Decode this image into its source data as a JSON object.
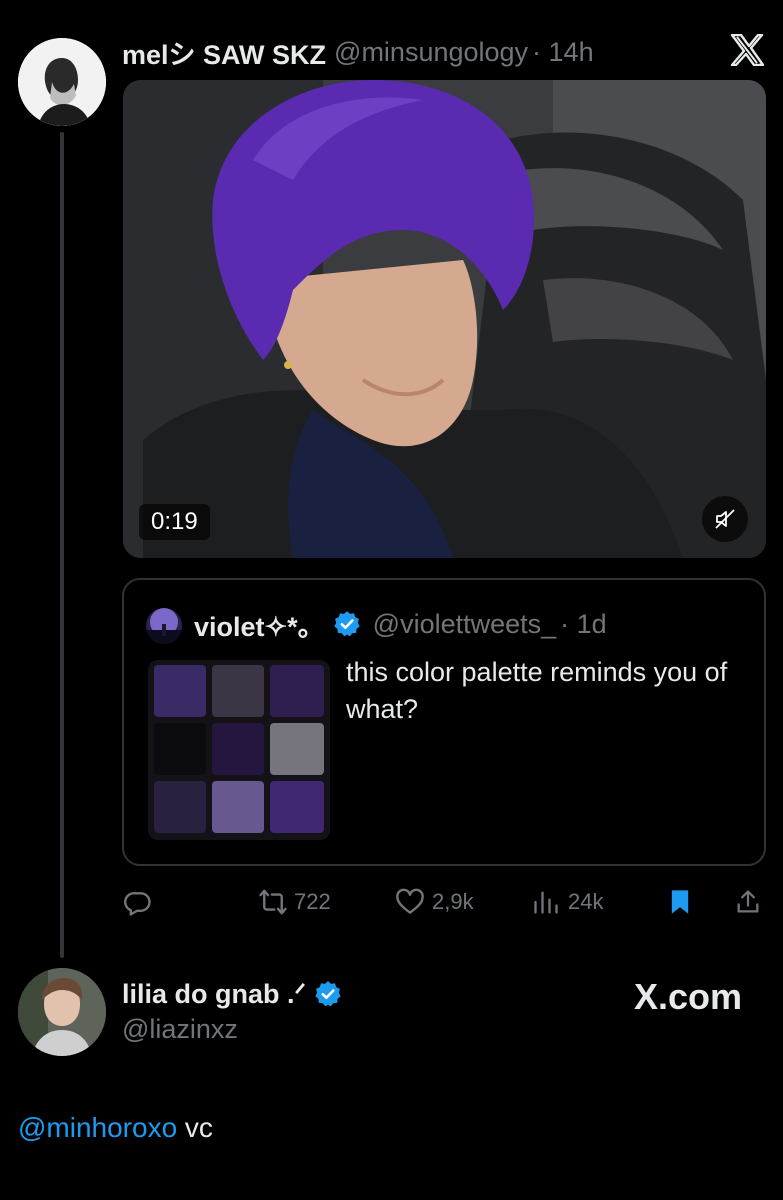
{
  "tweet": {
    "author_name": "melシ SAW SKZ",
    "author_handle": "@minsungology",
    "time": "· 14h",
    "media": {
      "duration": "0:19",
      "muted": true
    },
    "quote": {
      "author_name": "violet✧*。",
      "author_handle": "@violettweets_",
      "time": "· 1d",
      "text": "this color palette reminds you of what?",
      "verified": true
    },
    "actions": {
      "reply": "",
      "retweets": "722",
      "likes": "2,9k",
      "views": "24k",
      "bookmarked": true
    }
  },
  "reply": {
    "author_name": "lilia do gnab .ᐟ",
    "author_handle": "@liazinxz",
    "verified": true,
    "mention": "@minhoroxo",
    "text": " vc"
  },
  "brand": {
    "watermark": "X.com"
  },
  "colors": {
    "background": "#000000",
    "accent": "#1d9bf0",
    "muted": "#71767b",
    "text": "#e7e9ea"
  },
  "icons": [
    "x-logo-icon",
    "mute-icon",
    "verified-icon",
    "reply-icon",
    "retweet-icon",
    "like-icon",
    "views-icon",
    "bookmark-icon",
    "share-icon"
  ]
}
